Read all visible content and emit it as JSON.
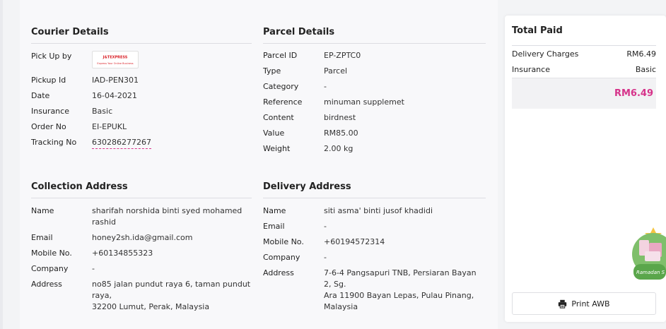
{
  "courier": {
    "title": "Courier Details",
    "pickup_by_label": "Pick Up by",
    "logo": {
      "mark": "J&T",
      "express": "EXPRESS",
      "tagline": "Express Your Online Business"
    },
    "rows": [
      {
        "label": "Pickup Id",
        "value": "IAD-PEN301"
      },
      {
        "label": "Date",
        "value": "16-04-2021"
      },
      {
        "label": "Insurance",
        "value": "Basic"
      },
      {
        "label": "Order No",
        "value": "EI-EPUKL"
      },
      {
        "label": "Tracking No",
        "value": "630286277267"
      }
    ]
  },
  "parcel": {
    "title": "Parcel Details",
    "rows": [
      {
        "label": "Parcel ID",
        "value": "EP-ZPTC0"
      },
      {
        "label": "Type",
        "value": "Parcel"
      },
      {
        "label": "Category",
        "value": "-"
      },
      {
        "label": "Reference",
        "value": "minuman supplemet"
      },
      {
        "label": "Content",
        "value": "birdnest"
      },
      {
        "label": "Value",
        "value": "RM85.00"
      },
      {
        "label": "Weight",
        "value": "2.00 kg"
      }
    ]
  },
  "collection": {
    "title": "Collection Address",
    "rows": [
      {
        "label": "Name",
        "value": "sharifah norshida binti syed mohamed rashid"
      },
      {
        "label": "Email",
        "value": "honey2sh.ida@gmail.com"
      },
      {
        "label": "Mobile No.",
        "value": "+60134855323"
      },
      {
        "label": "Company",
        "value": "-"
      },
      {
        "label": "Address",
        "line1": "no85 jalan pundut raya 6, taman pundut raya,",
        "line2": "32200 Lumut, Perak, Malaysia"
      }
    ]
  },
  "delivery": {
    "title": "Delivery Address",
    "rows": [
      {
        "label": "Name",
        "value": "siti asma' binti jusof khadidi"
      },
      {
        "label": "Email",
        "value": "-"
      },
      {
        "label": "Mobile No.",
        "value": "+60194572314"
      },
      {
        "label": "Company",
        "value": "-"
      },
      {
        "label": "Address",
        "line1": "7-6-4 Pangsapuri TNB, Persiaran Bayan 2, Sg.",
        "line2": "Ara 11900 Bayan Lepas, Pulau Pinang,",
        "line3": "Malaysia"
      }
    ]
  },
  "summary": {
    "title": "Total Paid",
    "delivery_label": "Delivery Charges",
    "delivery_value": "RM6.49",
    "insurance_label": "Insurance",
    "insurance_value": "Basic",
    "total": "RM6.49",
    "print_label": "Print AWB"
  },
  "promo": {
    "text": "Ramadan S"
  },
  "colors": {
    "accent": "#d6338a",
    "jt_red": "#d91f26"
  }
}
